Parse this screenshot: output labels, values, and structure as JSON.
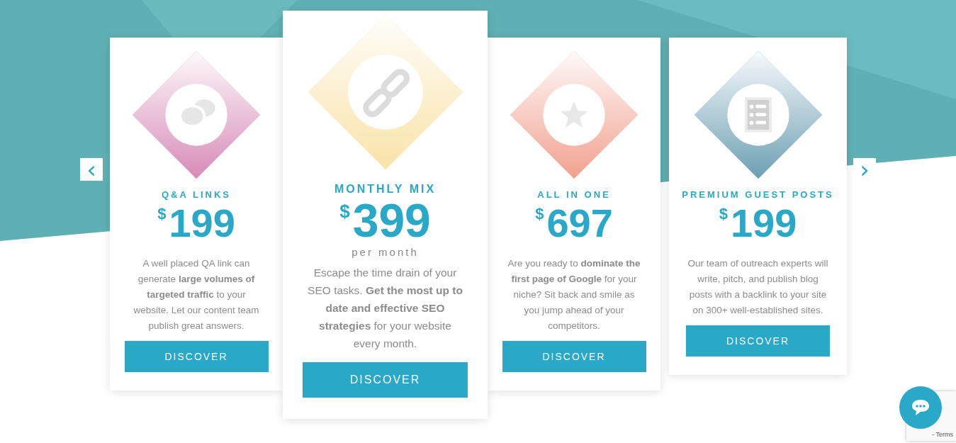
{
  "carousel": {
    "prev": "‹",
    "next": "›"
  },
  "plans": [
    {
      "title": "Q&A LINKS",
      "currency": "$",
      "price": "199",
      "featured": false,
      "kind": "chat",
      "color": "#d88bb7",
      "description": "A well placed QA link can generate **large volumes of targeted traffic** to your website. Let our content team publish great answers.",
      "button": "DISCOVER"
    },
    {
      "title": "MONTHLY MIX",
      "currency": "$",
      "price": "399",
      "period": "per month",
      "featured": true,
      "kind": "link",
      "color": "#fbe3a8",
      "description": "Escape the time drain of your SEO tasks. **Get the most up to date and effective SEO strategies** for your website every month.",
      "button": "DISCOVER"
    },
    {
      "title": "ALL IN ONE",
      "currency": "$",
      "price": "697",
      "featured": false,
      "kind": "star",
      "color": "#f2a08e",
      "description": "Are you ready to **dominate the first page of Google** for your niche? Sit back and smile as you jump ahead of your competitors.",
      "button": "DISCOVER"
    },
    {
      "title": "PREMIUM GUEST POSTS",
      "currency": "$",
      "price": "199",
      "featured": false,
      "kind": "list",
      "color": "#6c9fb3",
      "description": "Our team of outreach experts will write, pitch, and publish blog posts with a backlink to your site on 300+ well-established sites.",
      "button": "DISCOVER"
    }
  ],
  "recaptcha": {
    "text": "- Terms"
  }
}
